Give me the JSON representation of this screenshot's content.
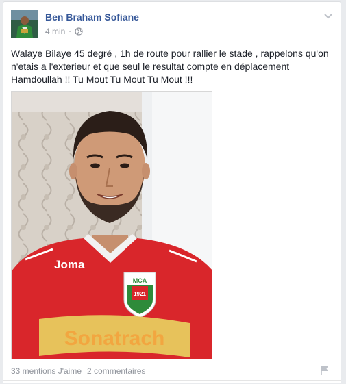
{
  "post": {
    "author": "Ben Braham Sofiane",
    "timestamp": "4 min",
    "separator": "·",
    "privacy_icon": "globe-icon",
    "text": "Walaye Bilaye 45 degré , 1h de route pour rallier le stade , rappelons qu'on n'etais a l'exterieur et que seul le resultat compte en déplacement Hamdoullah !! Tu Mout Tu Mout Tu Mout !!!",
    "photo": {
      "jersey_brand": "Joma",
      "jersey_sponsor": "Sonatrach",
      "crest_text": "MCA",
      "crest_year": "1921"
    }
  },
  "footer": {
    "likes": "33 mentions J'aime",
    "comments": "2 commentaires"
  },
  "icons": {
    "options": "chevron-down-icon",
    "report": "flag-icon"
  },
  "colors": {
    "author_link": "#365899",
    "meta_text": "#90949c",
    "jersey_red": "#d9262b"
  }
}
